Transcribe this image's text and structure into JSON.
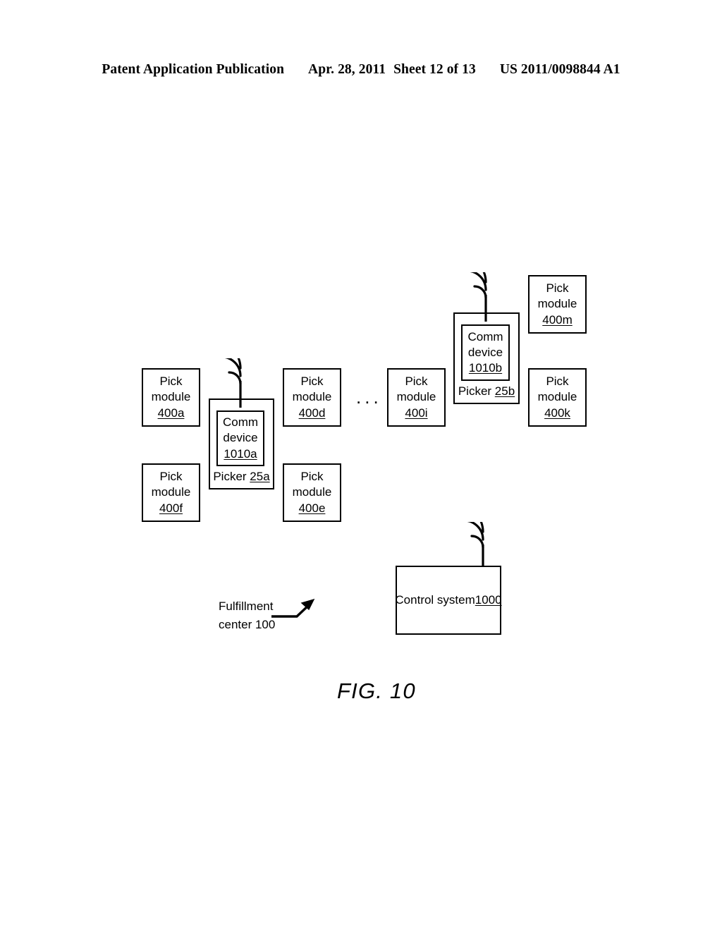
{
  "header": {
    "publication": "Patent Application Publication",
    "date": "Apr. 28, 2011",
    "sheet": "Sheet 12 of 13",
    "patent_number": "US 2011/0098844 A1"
  },
  "figure": {
    "caption": "FIG. 10",
    "ellipsis": "...",
    "callout": {
      "line1": "Fulfillment",
      "line2": "center 100"
    }
  },
  "pick_modules": [
    {
      "key": "400a",
      "line1": "Pick",
      "line2": "module",
      "ref": "400a"
    },
    {
      "key": "400f",
      "line1": "Pick",
      "line2": "module",
      "ref": "400f"
    },
    {
      "key": "400d",
      "line1": "Pick",
      "line2": "module",
      "ref": "400d"
    },
    {
      "key": "400e",
      "line1": "Pick",
      "line2": "module",
      "ref": "400e"
    },
    {
      "key": "400i",
      "line1": "Pick",
      "line2": "module",
      "ref": "400i"
    },
    {
      "key": "400m",
      "line1": "Pick",
      "line2": "module",
      "ref": "400m"
    },
    {
      "key": "400k",
      "line1": "Pick",
      "line2": "module",
      "ref": "400k"
    }
  ],
  "pickers": [
    {
      "key": "25a",
      "label_prefix": "Picker ",
      "label_ref": "25a",
      "comm_line1": "Comm",
      "comm_line2": "device",
      "comm_ref": "1010a"
    },
    {
      "key": "25b",
      "label_prefix": "Picker ",
      "label_ref": "25b",
      "comm_line1": "Comm",
      "comm_line2": "device",
      "comm_ref": "1010b"
    }
  ],
  "control_system": {
    "label": "Control system ",
    "ref": "1000"
  },
  "colors": {
    "ink": "#000000",
    "paper": "#ffffff"
  }
}
